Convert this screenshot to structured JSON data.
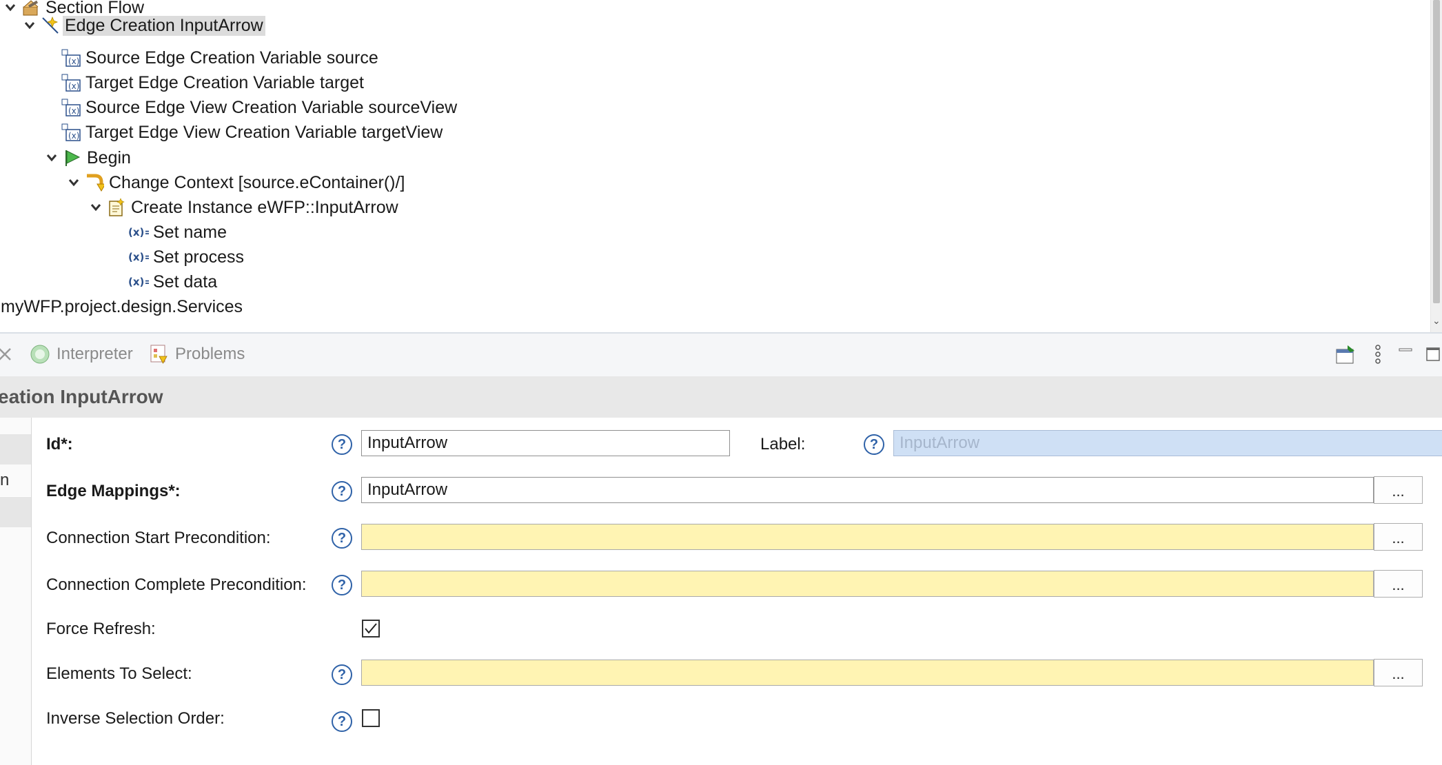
{
  "tree": {
    "items": [
      {
        "label": "Section Flow",
        "icon": "section-tool-icon",
        "expanded": true
      },
      {
        "label": "Edge Creation InputArrow",
        "icon": "edge-creation-icon",
        "expanded": true,
        "selected": true
      },
      {
        "label": "Source Edge Creation Variable source",
        "icon": "variable-icon"
      },
      {
        "label": "Target Edge Creation Variable target",
        "icon": "variable-icon"
      },
      {
        "label": "Source Edge View Creation Variable sourceView",
        "icon": "variable-icon"
      },
      {
        "label": "Target Edge View Creation Variable targetView",
        "icon": "variable-icon"
      },
      {
        "label": "Begin",
        "icon": "begin-flag-icon",
        "expanded": true
      },
      {
        "label": "Change Context [source.eContainer()/]",
        "icon": "change-context-icon",
        "expanded": true
      },
      {
        "label": "Create Instance eWFP::InputArrow",
        "icon": "create-instance-icon",
        "expanded": true
      },
      {
        "label": "Set name",
        "icon": "set-value-icon"
      },
      {
        "label": "Set process",
        "icon": "set-value-icon"
      },
      {
        "label": "Set data",
        "icon": "set-value-icon"
      },
      {
        "label": "myWFP.project.design.Services",
        "icon": ""
      }
    ]
  },
  "views": {
    "tabs": [
      {
        "label": "Interpreter",
        "icon": "interpreter-icon"
      },
      {
        "label": "Problems",
        "icon": "problems-icon"
      }
    ]
  },
  "properties": {
    "title": "eation InputArrow",
    "side_tabs": [
      "",
      "n",
      ""
    ],
    "id_label": "Id*:",
    "id_value": "InputArrow",
    "label_label": "Label:",
    "label_placeholder": "InputArrow",
    "edge_mappings_label": "Edge Mappings*:",
    "edge_mappings_value": "InputArrow",
    "conn_start_label": "Connection Start Precondition:",
    "conn_start_value": "",
    "conn_complete_label": "Connection Complete Precondition:",
    "conn_complete_value": "",
    "force_refresh_label": "Force Refresh:",
    "force_refresh_checked": true,
    "elements_select_label": "Elements To Select:",
    "elements_select_value": "",
    "inverse_order_label": "Inverse Selection Order:",
    "inverse_order_checked": false,
    "browse_label": "...",
    "help_label": "?"
  },
  "colors": {
    "selection": "#dcdcdc",
    "expression_field": "#fff4b3",
    "help_blue": "#2f62a8",
    "disabled_field": "#cfe0f5"
  }
}
